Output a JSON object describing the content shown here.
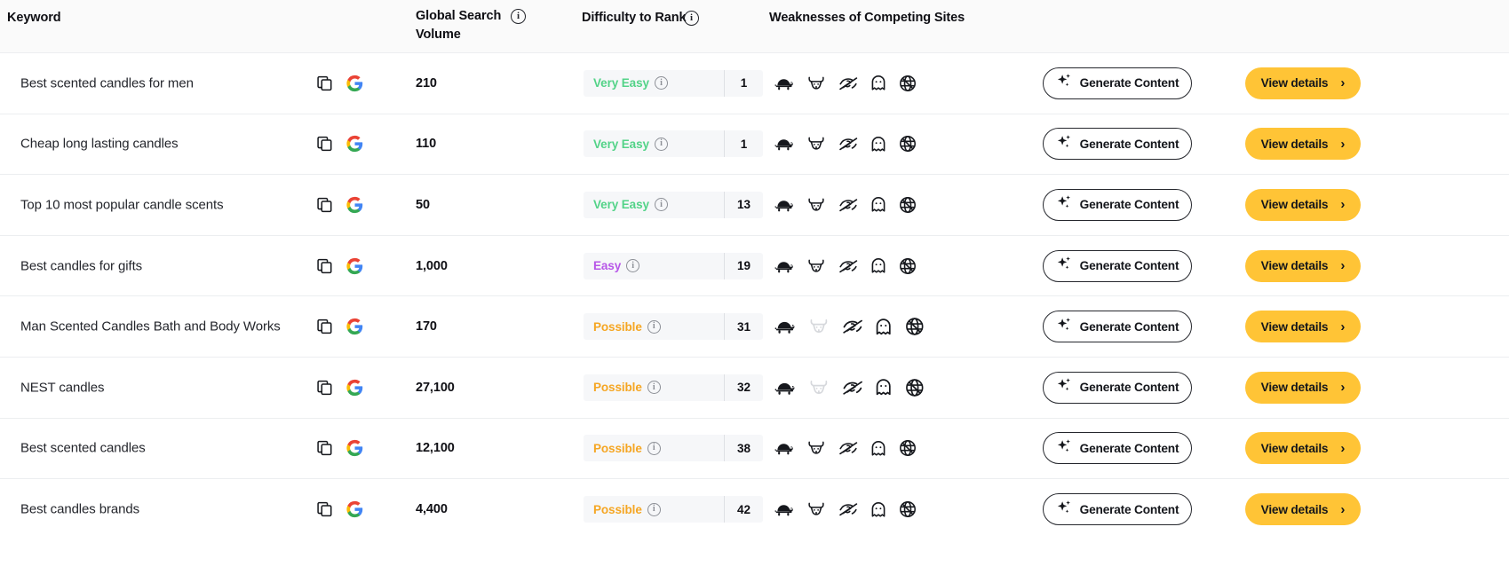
{
  "header": {
    "columns": [
      {
        "key": "keyword",
        "label": "Keyword",
        "info": false
      },
      {
        "key": "volume",
        "label": "Global Search Volume",
        "info": true,
        "info_glyph": "i"
      },
      {
        "key": "difficulty",
        "label": "Difficulty to Rank",
        "info": true,
        "info_glyph": "i"
      },
      {
        "key": "weaknesses",
        "label": "Weaknesses of Competing Sites",
        "info": false
      }
    ],
    "keyword_label": "Keyword",
    "volume_label_line1": "Global Search",
    "volume_label_line2": "Volume",
    "difficulty_label": "Difficulty to Rank",
    "weaknesses_label": "Weaknesses of Competing Sites",
    "info_glyph": "i"
  },
  "icons": {
    "copy": "copy-icon",
    "google": "google-icon",
    "info": "info-icon",
    "sparkle": "sparkle-icon",
    "chevron_right": "chevron-right-icon",
    "weaknesses": [
      "turtle-slow-speed-icon",
      "bull-aggressive-competition-icon",
      "eye-off-low-visibility-icon",
      "ghost-thin-content-icon",
      "globe-alert-poor-domain-icon"
    ]
  },
  "colors": {
    "accent_yellow": "#ffc436",
    "very_easy": "#53d388",
    "easy": "#b756e8",
    "possible": "#f5a623",
    "text": "#24262c",
    "bar_bg": "#f6f7f9",
    "header_bg": "#fafafa",
    "row_border": "#eceef0",
    "icon_active": "#16181d",
    "icon_muted": "#d6d8dc"
  },
  "buttons": {
    "generate_label": "Generate Content",
    "view_label": "View details",
    "chevron": "›"
  },
  "rows": [
    {
      "keyword": "Best scented candles for men",
      "volume": "210",
      "difficulty_label": "Very Easy",
      "difficulty_tone": "very_easy",
      "score": "1",
      "weaknesses_active": [
        true,
        true,
        true,
        true,
        true
      ],
      "icon_scale": 1.0
    },
    {
      "keyword": "Cheap long lasting candles",
      "volume": "110",
      "difficulty_label": "Very Easy",
      "difficulty_tone": "very_easy",
      "score": "1",
      "weaknesses_active": [
        true,
        true,
        true,
        true,
        true
      ],
      "icon_scale": 1.0
    },
    {
      "keyword": "Top 10 most popular candle scents",
      "volume": "50",
      "difficulty_label": "Very Easy",
      "difficulty_tone": "very_easy",
      "score": "13",
      "weaknesses_active": [
        true,
        true,
        true,
        true,
        true
      ],
      "icon_scale": 1.0
    },
    {
      "keyword": "Best candles for gifts",
      "volume": "1,000",
      "difficulty_label": "Easy",
      "difficulty_tone": "easy",
      "score": "19",
      "weaknesses_active": [
        true,
        true,
        true,
        true,
        true
      ],
      "icon_scale": 1.0
    },
    {
      "keyword": "Man Scented Candles Bath and Body Works",
      "volume": "170",
      "difficulty_label": "Possible",
      "difficulty_tone": "possible",
      "score": "31",
      "weaknesses_active": [
        true,
        false,
        true,
        true,
        true
      ],
      "icon_scale": 1.08
    },
    {
      "keyword": "NEST candles",
      "volume": "27,100",
      "difficulty_label": "Possible",
      "difficulty_tone": "possible",
      "score": "32",
      "weaknesses_active": [
        true,
        false,
        true,
        true,
        true
      ],
      "icon_scale": 1.08
    },
    {
      "keyword": "Best scented candles",
      "volume": "12,100",
      "difficulty_label": "Possible",
      "difficulty_tone": "possible",
      "score": "38",
      "weaknesses_active": [
        true,
        true,
        true,
        true,
        true
      ],
      "icon_scale": 1.0
    },
    {
      "keyword": "Best candles brands",
      "volume": "4,400",
      "difficulty_label": "Possible",
      "difficulty_tone": "possible",
      "score": "42",
      "weaknesses_active": [
        true,
        true,
        true,
        true,
        true
      ],
      "icon_scale": 1.0
    }
  ]
}
